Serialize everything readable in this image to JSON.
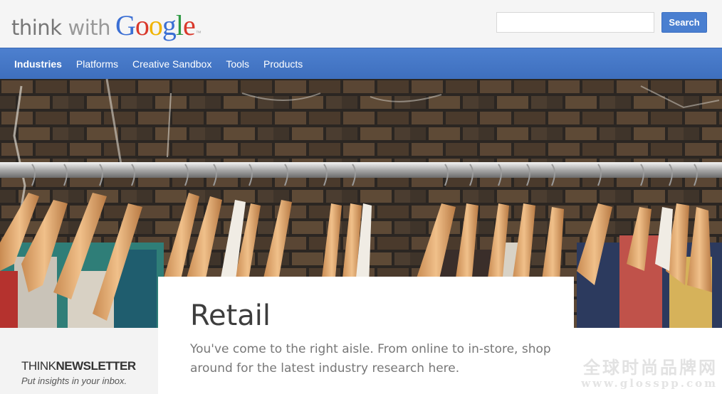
{
  "brand": {
    "think": "think",
    "with": "with",
    "google_letters": [
      {
        "ch": "G",
        "color": "#3b6fd4"
      },
      {
        "ch": "o",
        "color": "#d9382b"
      },
      {
        "ch": "o",
        "color": "#f0b400"
      },
      {
        "ch": "g",
        "color": "#3b6fd4"
      },
      {
        "ch": "l",
        "color": "#2f9a44"
      },
      {
        "ch": "e",
        "color": "#d9382b"
      }
    ]
  },
  "search": {
    "placeholder": "",
    "value": "",
    "button_label": "Search"
  },
  "nav": {
    "items": [
      {
        "label": "Industries",
        "active": true
      },
      {
        "label": "Platforms",
        "active": false
      },
      {
        "label": "Creative Sandbox",
        "active": false
      },
      {
        "label": "Tools",
        "active": false
      },
      {
        "label": "Products",
        "active": false
      }
    ]
  },
  "hero": {
    "image_icon": "clothes-rack-photo"
  },
  "article": {
    "title": "Retail",
    "description": "You've come to the right aisle. From online to in-store, shop around for the latest industry research here."
  },
  "newsletter": {
    "think": "THINK",
    "newsletter": "NEWSLETTER",
    "subtitle": "Put insights in your inbox."
  },
  "watermark": {
    "chinese": "全球时尚品牌网",
    "url": "www.glosspp.com"
  },
  "colors": {
    "nav_bg": "#4276c8",
    "search_button": "#4a7fd0"
  }
}
